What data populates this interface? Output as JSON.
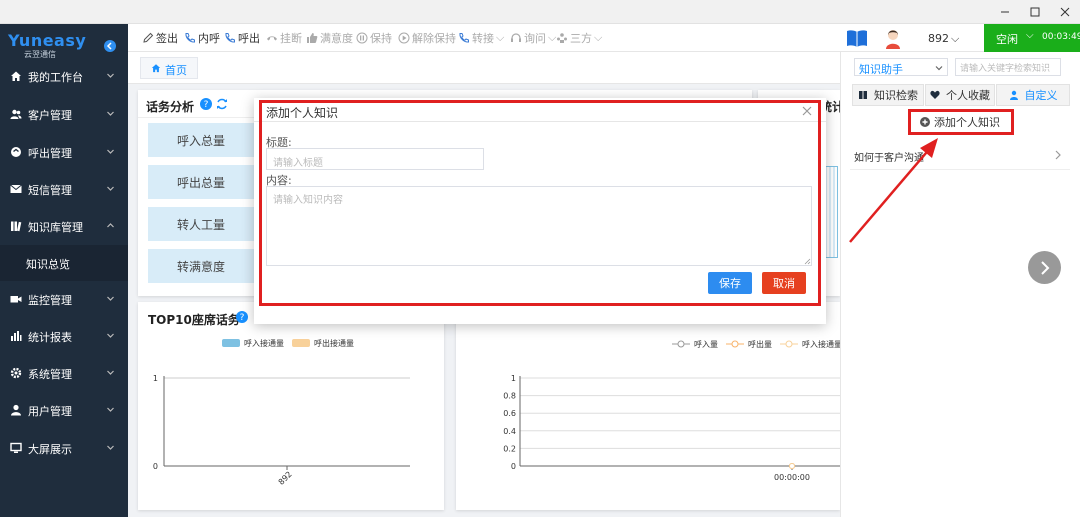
{
  "app": {
    "logo_main": "Yuneasy",
    "logo_sub": "云翌通信"
  },
  "sidebar": {
    "items": [
      {
        "label": "我的工作台",
        "icon": "home-icon"
      },
      {
        "label": "客户管理",
        "icon": "users-icon"
      },
      {
        "label": "呼出管理",
        "icon": "phone-out-icon"
      },
      {
        "label": "短信管理",
        "icon": "envelope-icon"
      },
      {
        "label": "知识库管理",
        "icon": "books-icon"
      },
      {
        "label": "知识总览",
        "icon": ""
      },
      {
        "label": "监控管理",
        "icon": "video-icon"
      },
      {
        "label": "统计报表",
        "icon": "bar-chart-icon"
      },
      {
        "label": "系统管理",
        "icon": "gear-icon"
      },
      {
        "label": "用户管理",
        "icon": "user-icon"
      },
      {
        "label": "大屏展示",
        "icon": "monitor-icon"
      }
    ]
  },
  "toolbar": {
    "items": [
      {
        "label": "签出",
        "icon": "pen-icon",
        "enabled": true
      },
      {
        "label": "内呼",
        "icon": "phone-icon",
        "enabled": true
      },
      {
        "label": "呼出",
        "icon": "phone-icon",
        "enabled": true
      },
      {
        "label": "挂断",
        "icon": "hangup-icon",
        "enabled": false
      },
      {
        "label": "满意度",
        "icon": "thumb-icon",
        "enabled": false
      },
      {
        "label": "保持",
        "icon": "pause-icon",
        "enabled": false
      },
      {
        "label": "解除保持",
        "icon": "play-icon",
        "enabled": false
      },
      {
        "label": "转接",
        "icon": "transfer-icon",
        "enabled": false,
        "dropdown": true
      },
      {
        "label": "询问",
        "icon": "headset-icon",
        "enabled": false,
        "dropdown": true
      },
      {
        "label": "三方",
        "icon": "conference-icon",
        "enabled": false,
        "dropdown": true
      }
    ]
  },
  "header": {
    "agent": "892",
    "status": "空闲",
    "timer": "00:03:49"
  },
  "breadcrumb": {
    "home": "首页"
  },
  "dashboard": {
    "talk_analysis_title": "话务分析",
    "stats": [
      "呼入总量",
      "呼出总量",
      "转人工量",
      "转满意度"
    ],
    "stats_partial_title": "统计",
    "top10_title": "TOP10座席话务",
    "colors": {
      "inbound": "#7ec1e2",
      "outbound": "#f8d19a",
      "accent": "#1890ff"
    }
  },
  "chart_data": [
    {
      "type": "bar",
      "title": "TOP10座席话务",
      "categories": [
        "892"
      ],
      "series": [
        {
          "name": "呼入接通量",
          "values": [
            0
          ]
        },
        {
          "name": "呼出接通量",
          "values": [
            0
          ]
        }
      ],
      "ylim": [
        0,
        1
      ],
      "yticks": [
        "0",
        "1"
      ],
      "legend": "top-center",
      "grid": true
    },
    {
      "type": "line",
      "categories": [
        "00:00:00"
      ],
      "series": [
        {
          "name": "呼入量",
          "values": [
            0
          ]
        },
        {
          "name": "呼出量",
          "values": [
            0
          ]
        },
        {
          "name": "呼入接通量",
          "values": [
            0
          ]
        }
      ],
      "ylim": [
        0,
        1
      ],
      "yticks": [
        "0",
        "0.2",
        "0.4",
        "0.6",
        "0.8",
        "1"
      ],
      "legend": "top-right",
      "grid": true
    }
  ],
  "modal": {
    "title": "添加个人知识",
    "title_label": "标题:",
    "title_placeholder": "请输入标题",
    "content_label": "内容:",
    "content_placeholder": "请输入知识内容",
    "save": "保存",
    "cancel": "取消"
  },
  "right_panel": {
    "helper_select": "知识助手",
    "search_placeholder": "请输入关键字检索知识",
    "tabs": [
      "知识检索",
      "个人收藏",
      "自定义"
    ],
    "add_button": "添加个人知识",
    "list": [
      "如何于客户沟通"
    ]
  }
}
